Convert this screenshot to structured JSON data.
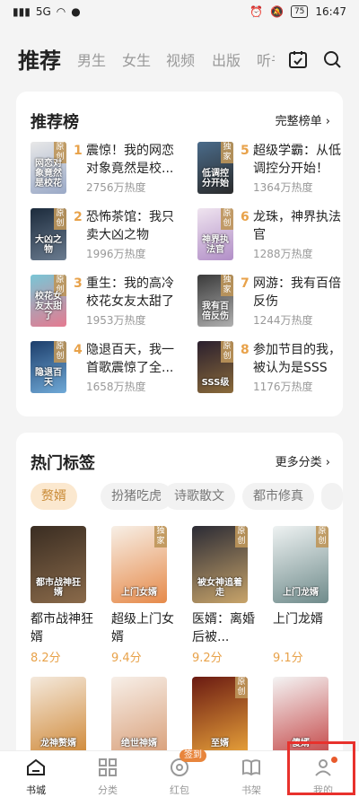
{
  "status": {
    "left_text": "5G",
    "battery": "75",
    "time": "16:47"
  },
  "top_tabs": [
    "推荐",
    "男生",
    "女生",
    "视频",
    "出版",
    "听书"
  ],
  "ranking": {
    "title": "推荐榜",
    "more": "完整榜单 ›",
    "items": [
      {
        "rank": "1",
        "title": "震惊！我的网恋对象竟然是校...",
        "heat": "2756万热度",
        "badge": "原创",
        "cover_text": "网恋对象竟然是校花",
        "c1": "#e8e8e8",
        "c2": "#9aa9c7"
      },
      {
        "rank": "2",
        "title": "恐怖茶馆：我只卖大凶之物",
        "heat": "1996万热度",
        "badge": "原创",
        "cover_text": "大凶之物",
        "c1": "#1c2b3c",
        "c2": "#6a7b8f"
      },
      {
        "rank": "3",
        "title": "重生：我的高冷校花女友太甜了",
        "heat": "1953万热度",
        "badge": "原创",
        "cover_text": "校花女友太甜了",
        "c1": "#79c6d6",
        "c2": "#e57a90"
      },
      {
        "rank": "4",
        "title": "隐退百天，我一首歌震惊了全...",
        "heat": "1658万热度",
        "badge": "原创",
        "cover_text": "隐退百天",
        "c1": "#1d3e6b",
        "c2": "#6fa9d7"
      },
      {
        "rank": "5",
        "title": "超级学霸：从低调控分开始！",
        "heat": "1364万热度",
        "badge": "独家",
        "cover_text": "低调控分开始",
        "c1": "#4a6b8a",
        "c2": "#2b2b2b"
      },
      {
        "rank": "6",
        "title": "龙珠，神界执法官",
        "heat": "1288万热度",
        "badge": "原创",
        "cover_text": "神界执法官",
        "c1": "#efe4ef",
        "c2": "#b18ec7"
      },
      {
        "rank": "7",
        "title": "网游：我有百倍反伤",
        "heat": "1244万热度",
        "badge": "独家",
        "cover_text": "我有百倍反伤",
        "c1": "#3a3a3a",
        "c2": "#b0b0b0"
      },
      {
        "rank": "8",
        "title": "参加节目的我，被认为是SSS级...",
        "heat": "1176万热度",
        "badge": "原创",
        "cover_text": "SSS级",
        "c1": "#2a1f2e",
        "c2": "#8a6a3a"
      }
    ]
  },
  "tags": {
    "title": "热门标签",
    "more": "更多分类 ›",
    "chips": [
      "赘婿",
      "扮猪吃虎",
      "诗歌散文",
      "都市修真"
    ]
  },
  "books": [
    {
      "title": "都市战神狂婿",
      "score": "8.2分",
      "badge": "",
      "cover_text": "都市战神狂婿",
      "c1": "#3a2d22",
      "c2": "#8a6a4a"
    },
    {
      "title": "超级上门女婿",
      "score": "9.4分",
      "badge": "独家",
      "cover_text": "上门女婿",
      "c1": "#f7efe6",
      "c2": "#e68a4a"
    },
    {
      "title": "医婿：离婚后被...",
      "score": "9.2分",
      "badge": "原创",
      "cover_text": "被女神追着走",
      "c1": "#2b2b35",
      "c2": "#c8a46a"
    },
    {
      "title": "上门龙婿",
      "score": "9.1分",
      "badge": "原创",
      "cover_text": "上门龙婿",
      "c1": "#eef2f2",
      "c2": "#6f8b8b"
    },
    {
      "title": "",
      "score": "",
      "badge": "",
      "cover_text": "龙神赘婿",
      "c1": "#f4e9dc",
      "c2": "#d08a3a"
    },
    {
      "title": "",
      "score": "",
      "badge": "",
      "cover_text": "绝世神婿",
      "c1": "#f7efe8",
      "c2": "#d9a07a"
    },
    {
      "title": "",
      "score": "",
      "badge": "原创",
      "cover_text": "至婿",
      "c1": "#6a1a12",
      "c2": "#e8a23a"
    },
    {
      "title": "",
      "score": "",
      "badge": "",
      "cover_text": "傻婿",
      "c1": "#f4f4f4",
      "c2": "#c54a4a"
    }
  ],
  "bottom_nav": {
    "items": [
      "书城",
      "分类",
      "红包",
      "书架",
      "我的"
    ],
    "sign_badge": "签到"
  }
}
